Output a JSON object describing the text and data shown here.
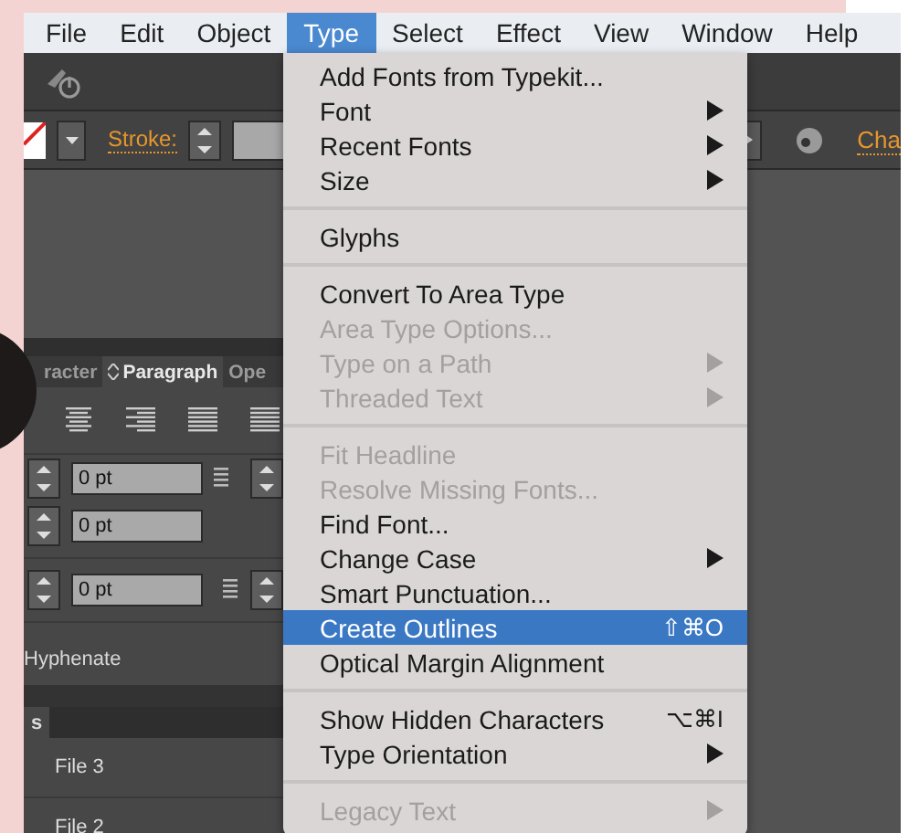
{
  "menubar": [
    {
      "label": "File",
      "selected": false
    },
    {
      "label": "Edit",
      "selected": false
    },
    {
      "label": "Object",
      "selected": false
    },
    {
      "label": "Type",
      "selected": true
    },
    {
      "label": "Select",
      "selected": false
    },
    {
      "label": "Effect",
      "selected": false
    },
    {
      "label": "View",
      "selected": false
    },
    {
      "label": "Window",
      "selected": false
    },
    {
      "label": "Help",
      "selected": false
    }
  ],
  "control_bar": {
    "stroke_label": "Stroke:",
    "right_label": "Cha"
  },
  "paragraph_panel": {
    "tabs": [
      {
        "label": "racter",
        "selected": false
      },
      {
        "label": "Paragraph",
        "selected": true
      },
      {
        "label": "Ope",
        "selected": false
      }
    ],
    "fields": [
      {
        "value": "0 pt"
      },
      {
        "value": "0 pt"
      },
      {
        "value": "0 pt"
      }
    ],
    "hyphenate": "Hyphenate"
  },
  "layers_panel": {
    "tab": "s",
    "rows": [
      "File 3",
      "File 2"
    ]
  },
  "type_menu": {
    "groups": [
      [
        {
          "label": "Add Fonts from Typekit...",
          "submenu": false,
          "disabled": false,
          "selected": false
        },
        {
          "label": "Font",
          "submenu": true,
          "disabled": false,
          "selected": false
        },
        {
          "label": "Recent Fonts",
          "submenu": true,
          "disabled": false,
          "selected": false
        },
        {
          "label": "Size",
          "submenu": true,
          "disabled": false,
          "selected": false
        }
      ],
      [
        {
          "label": "Glyphs",
          "submenu": false,
          "disabled": false,
          "selected": false
        }
      ],
      [
        {
          "label": "Convert To Area Type",
          "submenu": false,
          "disabled": false,
          "selected": false
        },
        {
          "label": "Area Type Options...",
          "submenu": false,
          "disabled": true,
          "selected": false
        },
        {
          "label": "Type on a Path",
          "submenu": true,
          "disabled": true,
          "selected": false
        },
        {
          "label": "Threaded Text",
          "submenu": true,
          "disabled": true,
          "selected": false
        }
      ],
      [
        {
          "label": "Fit Headline",
          "submenu": false,
          "disabled": true,
          "selected": false
        },
        {
          "label": "Resolve Missing Fonts...",
          "submenu": false,
          "disabled": true,
          "selected": false
        },
        {
          "label": "Find Font...",
          "submenu": false,
          "disabled": false,
          "selected": false
        },
        {
          "label": "Change Case",
          "submenu": true,
          "disabled": false,
          "selected": false
        },
        {
          "label": "Smart Punctuation...",
          "submenu": false,
          "disabled": false,
          "selected": false
        },
        {
          "label": "Create Outlines",
          "submenu": false,
          "disabled": false,
          "selected": true,
          "shortcut": "⇧⌘O"
        },
        {
          "label": "Optical Margin Alignment",
          "submenu": false,
          "disabled": false,
          "selected": false
        }
      ],
      [
        {
          "label": "Show Hidden Characters",
          "submenu": false,
          "disabled": false,
          "selected": false,
          "shortcut": "⌥⌘I"
        },
        {
          "label": "Type Orientation",
          "submenu": true,
          "disabled": false,
          "selected": false
        }
      ],
      [
        {
          "label": "Legacy Text",
          "submenu": true,
          "disabled": true,
          "selected": false
        }
      ]
    ]
  }
}
